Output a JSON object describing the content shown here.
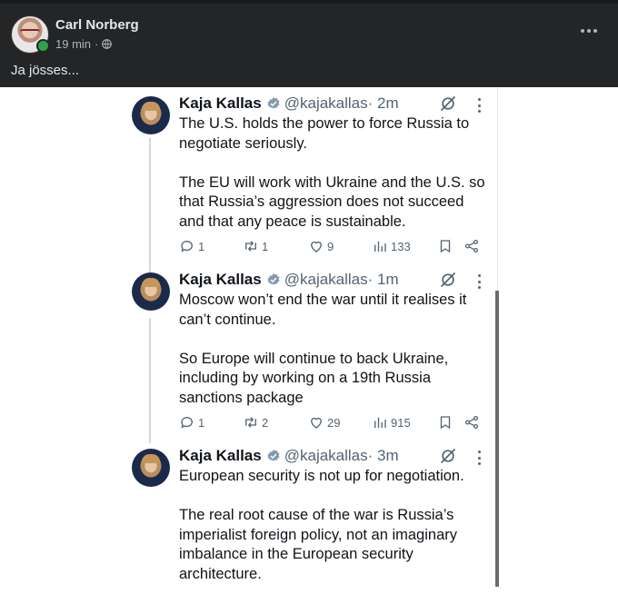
{
  "post": {
    "author": "Carl Norberg",
    "time": "19 min",
    "separator": "·",
    "text": "Ja jösses..."
  },
  "icons": {
    "verified": "verified-badge-icon",
    "grok": "grok-icon",
    "reply": "reply-icon",
    "retweet": "retweet-icon",
    "like": "like-icon",
    "views": "views-icon",
    "bookmark": "bookmark-icon",
    "share": "share-icon"
  },
  "colors": {
    "verified": "#829aab",
    "fb_bg": "#242526",
    "text_dark": "#0f1419",
    "muted": "#536471"
  },
  "tweets": [
    {
      "name": "Kaja Kallas",
      "handle": "@kajakallas",
      "time": "· 2m",
      "paragraphs": [
        "The U.S. holds the power to force Russia to negotiate seriously.",
        "The EU will work with Ukraine and the U.S. so that Russia’s aggression does not succeed and that any peace is sustainable."
      ],
      "replies": "1",
      "retweets": "1",
      "likes": "9",
      "views": "133"
    },
    {
      "name": "Kaja Kallas",
      "handle": "@kajakallas",
      "time": "· 1m",
      "paragraphs": [
        "Moscow won’t end the war until it realises it can’t continue.",
        "So Europe will continue to back Ukraine, including by working on a 19th Russia sanctions package"
      ],
      "replies": "1",
      "retweets": "2",
      "likes": "29",
      "views": "915"
    },
    {
      "name": "Kaja Kallas",
      "handle": "@kajakallas",
      "time": "· 3m",
      "paragraphs": [
        "European security is not up for negotiation.",
        "The real root cause of the war is Russia’s imperialist foreign policy, not an imaginary imbalance in the European security architecture."
      ]
    }
  ]
}
